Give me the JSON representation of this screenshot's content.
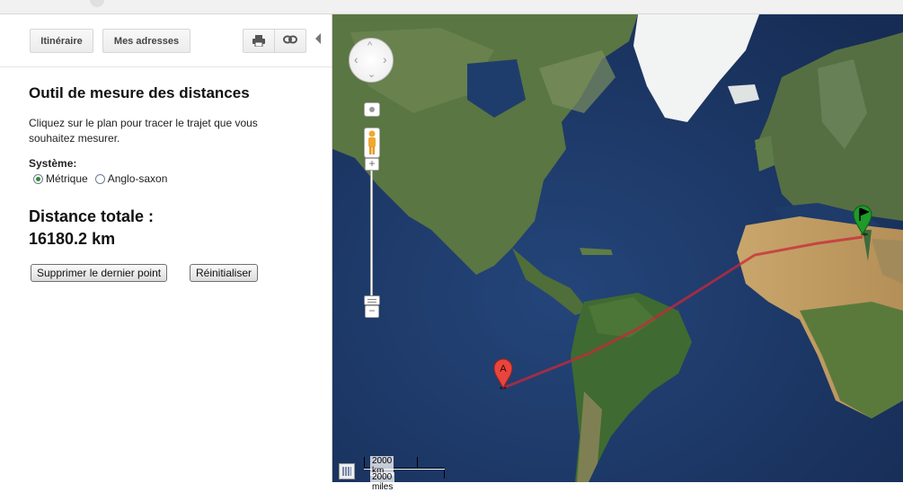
{
  "toolbar": {
    "itinerary_label": "Itinéraire",
    "addresses_label": "Mes adresses",
    "print_icon": "printer-icon",
    "link_icon": "link-icon",
    "collapse_icon": "collapse-arrow-icon"
  },
  "tool": {
    "title": "Outil de mesure des distances",
    "description": "Cliquez sur le plan pour tracer le trajet que vous souhaitez mesurer.",
    "system_label": "Système:",
    "options": [
      {
        "label": "Métrique",
        "selected": true
      },
      {
        "label": "Anglo-saxon",
        "selected": false
      }
    ],
    "total_label": "Distance totale :",
    "total_value": "16180.2 km",
    "undo_label": "Supprimer le dernier point",
    "reset_label": "Réinitialiser"
  },
  "map": {
    "marker_a_label": "A",
    "route_color": "#c8283a",
    "marker_a_color": "#e8453c",
    "marker_b_color": "#1f9a2b",
    "scale_km": "2000 km",
    "scale_miles": "2000 miles"
  },
  "colors": {
    "ocean": "#1e3b69",
    "land": "#5d7b44",
    "desert": "#c9a66b"
  }
}
